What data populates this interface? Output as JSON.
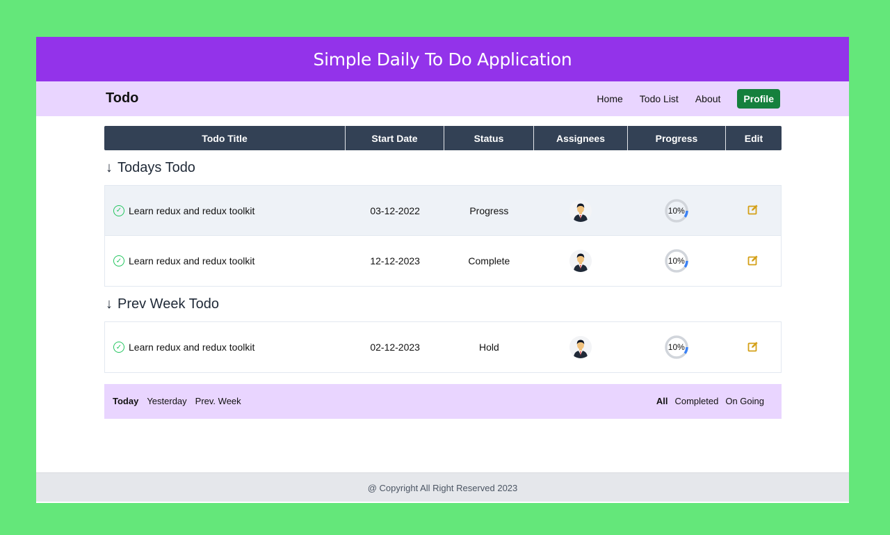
{
  "app_title": "Simple Daily To Do Application",
  "nav": {
    "brand": "Todo",
    "links": [
      "Home",
      "Todo List",
      "About"
    ],
    "profile": "Profile"
  },
  "table": {
    "headers": [
      "Todo Title",
      "Start Date",
      "Status",
      "Assignees",
      "Progress",
      "Edit"
    ]
  },
  "sections": [
    {
      "title": "Todays Todo",
      "rows": [
        {
          "title": "Learn redux and redux toolkit",
          "date": "03-12-2022",
          "status": "Progress",
          "progress": "10%"
        },
        {
          "title": "Learn redux and redux toolkit",
          "date": "12-12-2023",
          "status": "Complete",
          "progress": "10%"
        }
      ]
    },
    {
      "title": "Prev Week Todo",
      "rows": [
        {
          "title": "Learn redux and redux toolkit",
          "date": "02-12-2023",
          "status": "Hold",
          "progress": "10%"
        }
      ]
    }
  ],
  "filters": {
    "left": [
      "Today",
      "Yesterday",
      "Prev. Week"
    ],
    "right": [
      "All",
      "Completed",
      "On Going"
    ]
  },
  "footer": "@ Copyright All Right Reserved 2023",
  "colors": {
    "background": "#64e77a",
    "banner": "#9333ea",
    "nav": "#e9d5ff",
    "table_header": "#334155",
    "profile_button": "#15803d",
    "edit_icon": "#d4a017"
  },
  "icons": {
    "section": "arrow-down-icon",
    "row_status": "check-circle-icon",
    "assignee": "avatar-icon",
    "edit": "edit-icon"
  }
}
